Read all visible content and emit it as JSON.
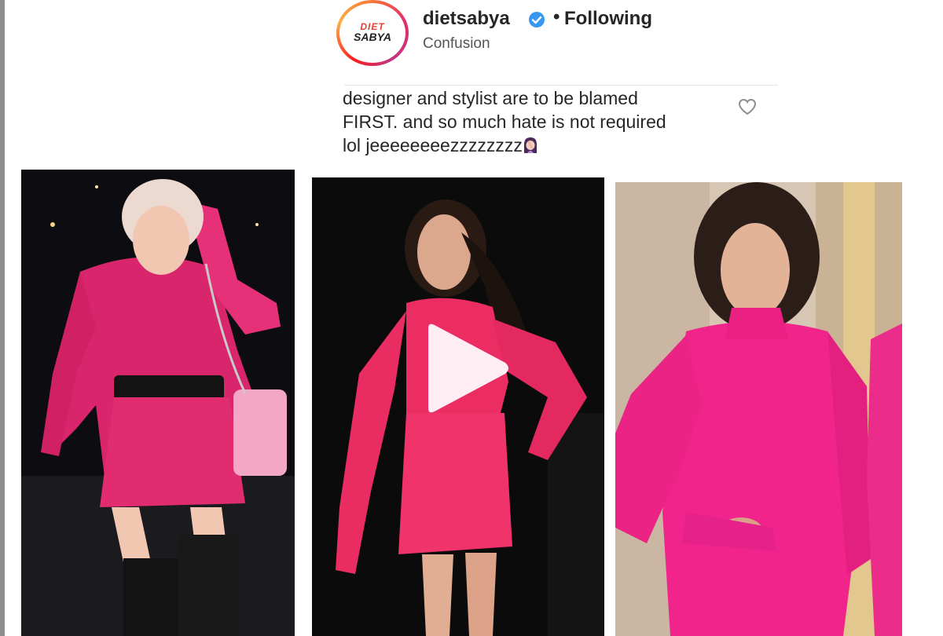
{
  "post": {
    "username": "dietsabya",
    "verified": true,
    "separator": "•",
    "follow_status": "Following",
    "subtitle": "Confusion",
    "avatar": {
      "logo_line1": "DIET",
      "logo_line2": "SABYA"
    }
  },
  "comment": {
    "line1": "designer and stylist are to be blamed",
    "line2": "FIRST. and so much hate is not required",
    "line3": "lol jeeeeeeeezzzzzzzz",
    "emoji": "woman-facepalming-emoji",
    "like_icon": "heart-outline-icon"
  },
  "photos": [
    {
      "name": "photo-woman-pink-satin-dress-night-street",
      "dress_color": "#e0286a"
    },
    {
      "name": "video-woman-pink-satin-dress",
      "dress_color": "#ee2f64",
      "overlay_icon": "play-icon"
    },
    {
      "name": "photo-woman-pink-satin-dress-indoor",
      "dress_color": "#f0248a"
    }
  ],
  "colors": {
    "verified_blue": "#3897f0",
    "text": "#262626"
  }
}
